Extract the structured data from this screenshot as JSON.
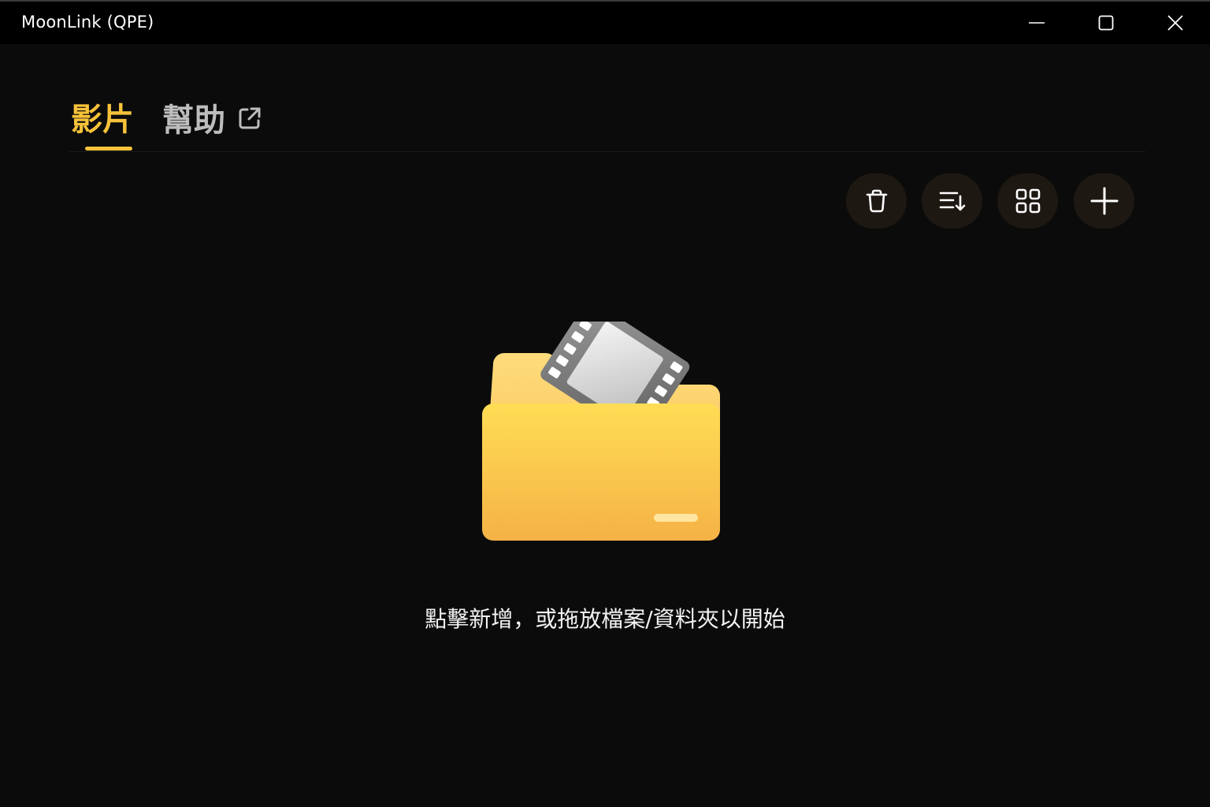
{
  "window": {
    "title": "MoonLink (QPE)"
  },
  "tabs": [
    {
      "label": "影片",
      "active": true
    },
    {
      "label": "幫助",
      "icon": "external-link-icon",
      "active": false
    }
  ],
  "toolbar": {
    "buttons": [
      {
        "icon": "trash-icon"
      },
      {
        "icon": "sort-icon"
      },
      {
        "icon": "grid-view-icon"
      },
      {
        "icon": "plus-icon"
      }
    ]
  },
  "empty_state": {
    "icon": "folder-film-icon",
    "message": "點擊新增，或拖放檔案/資料夾以開始"
  },
  "colors": {
    "accent": "#f7c23a",
    "background": "#0b0b0b",
    "titlebar": "#000000",
    "button_bg": "#1d1812"
  }
}
